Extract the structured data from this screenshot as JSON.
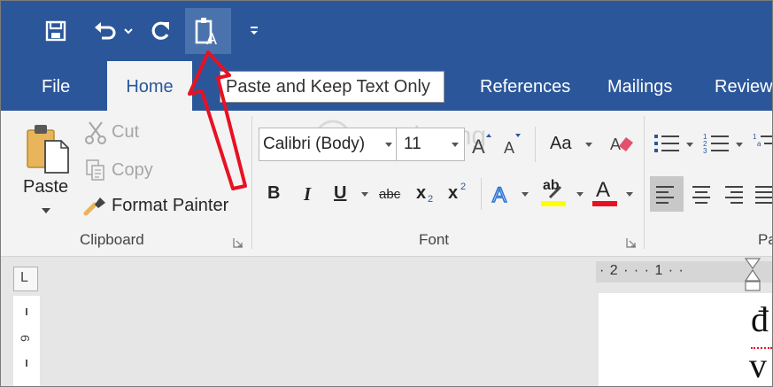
{
  "quick_access": {
    "save_icon": "save-icon",
    "undo_icon": "undo-icon",
    "redo_icon": "redo-icon",
    "paste_text_icon": "paste-text-only-icon",
    "customize_icon": "customize-qat-icon"
  },
  "tabs": {
    "file": "File",
    "home": "Home",
    "references": "References",
    "mailings": "Mailings",
    "review": "Review"
  },
  "tooltip": "Paste and Keep Text Only",
  "clipboard": {
    "paste": "Paste",
    "cut": "Cut",
    "copy": "Copy",
    "format_painter": "Format Painter",
    "group_label": "Clipboard"
  },
  "font": {
    "font_name": "Calibri (Body)",
    "font_size": "11",
    "bold": "B",
    "italic": "I",
    "underline": "U",
    "strikethrough": "abc",
    "subscript": "x",
    "subscript_mark": "2",
    "superscript": "x",
    "superscript_mark": "2",
    "change_case": "Aa",
    "font_color_letter": "A",
    "highlight_letters": "ab",
    "group_label": "Font"
  },
  "paragraph": {
    "group_label": "Pa"
  },
  "ruler": {
    "horizontal": "· 2 · · · 1 · ·",
    "vertical_mark": "9",
    "corner": "L"
  },
  "document": {
    "line1": "đ",
    "line2": "v"
  },
  "watermark": "uantrimang",
  "colors": {
    "accent": "#2b579a",
    "highlight": "#ffff00",
    "font_color": "#e81123",
    "annotation_arrow": "#e81123"
  }
}
